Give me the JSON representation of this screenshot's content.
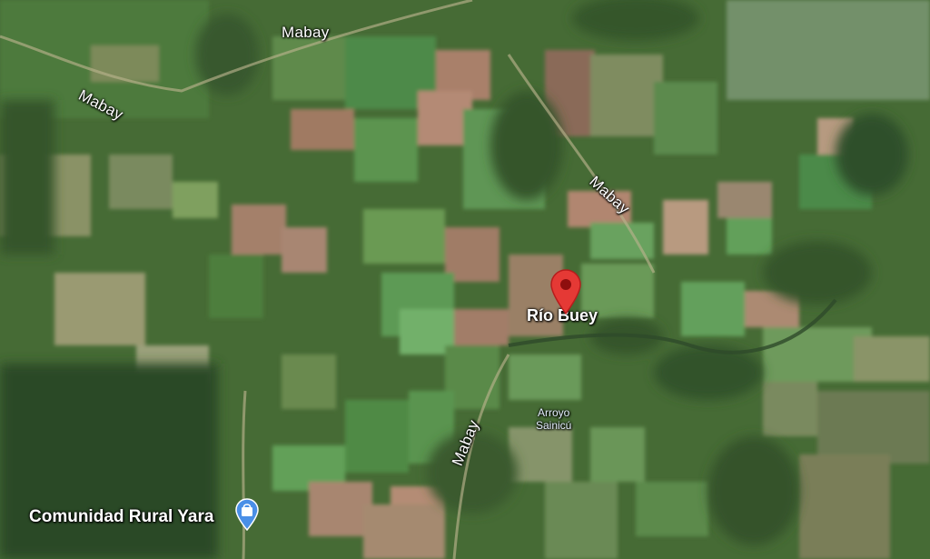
{
  "map": {
    "view": "satellite",
    "roads": [
      {
        "id": "mabay-top",
        "label": "Mabay"
      },
      {
        "id": "mabay-left",
        "label": "Mabay"
      },
      {
        "id": "mabay-right",
        "label": "Mabay"
      },
      {
        "id": "mabay-bottom",
        "label": "Mabay"
      }
    ],
    "places": {
      "rio_buey": "Río Buey",
      "arroyo_line1": "Arroyo",
      "arroyo_line2": "Sainicú",
      "comunidad": "Comunidad Rural Yara"
    },
    "markers": {
      "selected_pin_icon": "map-pin-icon",
      "selected_pin_color": "#e53935",
      "poi_icon": "shopping-bag-icon",
      "poi_color": "#4a8fe7"
    }
  }
}
